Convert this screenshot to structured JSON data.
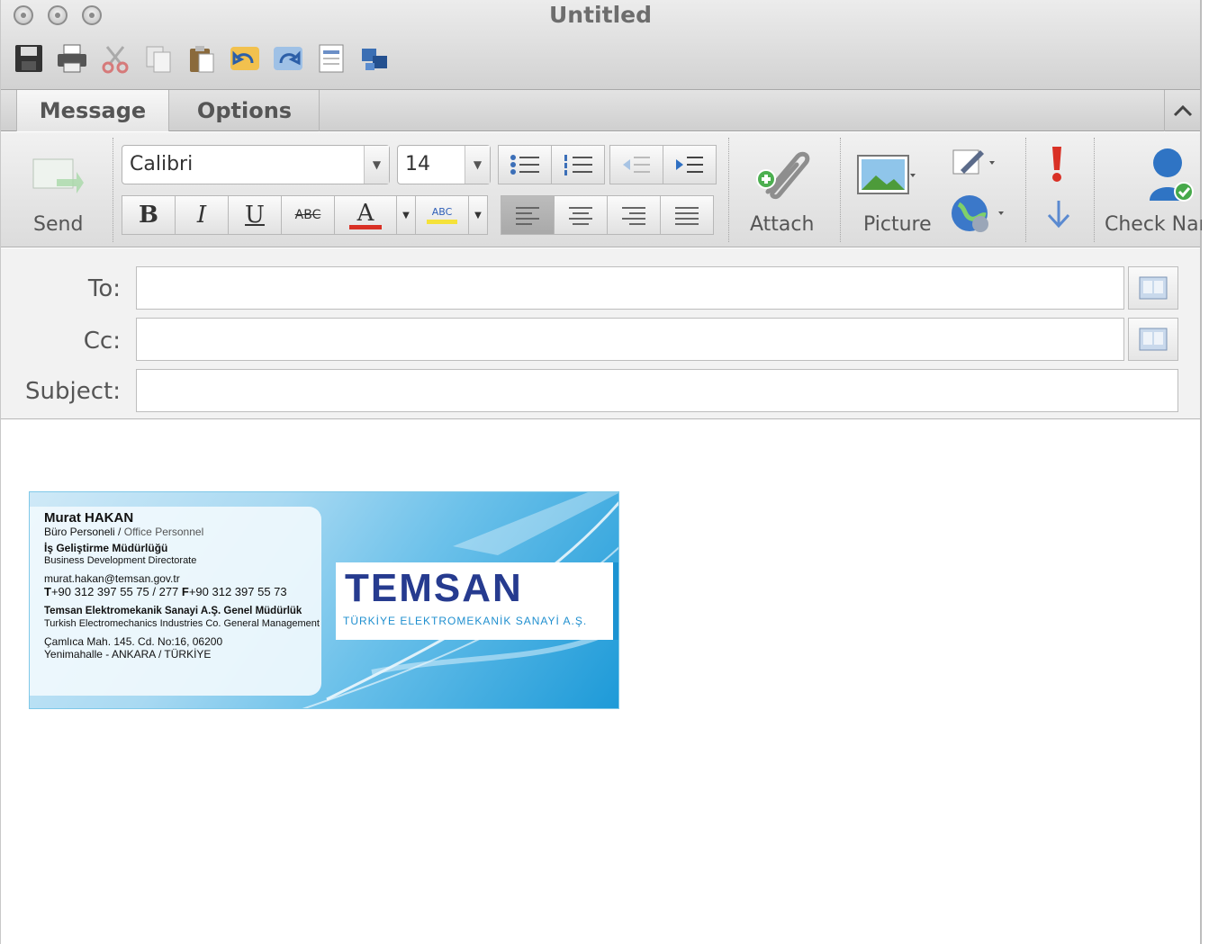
{
  "window": {
    "title": "Untitled"
  },
  "toolbar": {
    "icons": [
      "save-icon",
      "print-icon",
      "cut-icon",
      "copy-icon",
      "paste-icon",
      "undo-icon",
      "redo-icon",
      "insert-icon",
      "media-browser-icon"
    ]
  },
  "tabs": {
    "message": "Message",
    "options": "Options"
  },
  "ribbon": {
    "send_label": "Send",
    "font_name": "Calibri",
    "font_size": "14",
    "bold": "B",
    "italic": "I",
    "underline": "U",
    "strike": "ABC",
    "font_color": "A",
    "highlight": "ABC",
    "attach_label": "Attach",
    "picture_label": "Picture",
    "check_names_label": "Check Nar"
  },
  "fields": {
    "to_label": "To:",
    "cc_label": "Cc:",
    "subject_label": "Subject:",
    "to_value": "",
    "cc_value": "",
    "subject_value": ""
  },
  "signature": {
    "name": "Murat HAKAN",
    "title_tr": "Büro Personeli",
    "title_sep": " / ",
    "title_en": "Office Personnel",
    "dept_tr": "İş Geliştirme Müdürlüğü",
    "dept_en": "Business Development Directorate",
    "email": "murat.hakan@temsan.gov.tr",
    "phone_prefix": "T",
    "phone": "+90 312 397 55 75 / 277 ",
    "fax_prefix": "F",
    "fax": "+90 312 397 55 73",
    "company_tr": "Temsan Elektromekanik Sanayi A.Ş. Genel Müdürlük",
    "company_en": "Turkish Electromechanics Industries Co. General Management",
    "address_1": "Çamlıca Mah. 145. Cd. No:16, 06200",
    "address_2": "Yenimahalle - ANKARA / TÜRKİYE",
    "logo_word": "TEMSAN",
    "logo_tagline": "TÜRKİYE ELEKTROMEKANİK SANAYİ A.Ş."
  },
  "colors": {
    "logo_navy": "#263b8f",
    "logo_blue": "#1f8fcf",
    "accent_red": "#d93025"
  }
}
